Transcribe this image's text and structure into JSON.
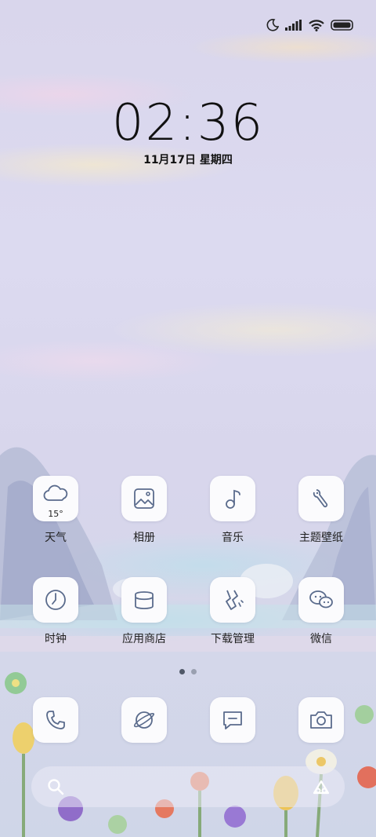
{
  "status_bar": {
    "icons": [
      "moon-icon",
      "signal-icon",
      "wifi-icon",
      "battery-icon"
    ]
  },
  "lock": {
    "time": "02:36",
    "date": "11月17日 星期四"
  },
  "apps_row1": [
    {
      "label": "天气",
      "icon": "weather-cloud-icon",
      "temp": "15°"
    },
    {
      "label": "相册",
      "icon": "gallery-icon"
    },
    {
      "label": "音乐",
      "icon": "music-note-icon"
    },
    {
      "label": "主题壁纸",
      "icon": "paintbrush-icon"
    }
  ],
  "apps_row2": [
    {
      "label": "时钟",
      "icon": "clock-icon"
    },
    {
      "label": "应用商店",
      "icon": "app-store-icon"
    },
    {
      "label": "下载管理",
      "icon": "download-icon"
    },
    {
      "label": "微信",
      "icon": "wechat-icon"
    }
  ],
  "dock": [
    {
      "icon": "phone-icon"
    },
    {
      "icon": "browser-planet-icon"
    },
    {
      "icon": "messages-icon"
    },
    {
      "icon": "camera-icon"
    }
  ],
  "page_indicator": {
    "pages": 2,
    "current": 1
  },
  "search": {
    "left_icon": "search-icon",
    "right_icon": "assistant-icon"
  },
  "colors": {
    "icon_stroke": "#5a6b8c",
    "tile_bg": "#fbfbfd"
  }
}
